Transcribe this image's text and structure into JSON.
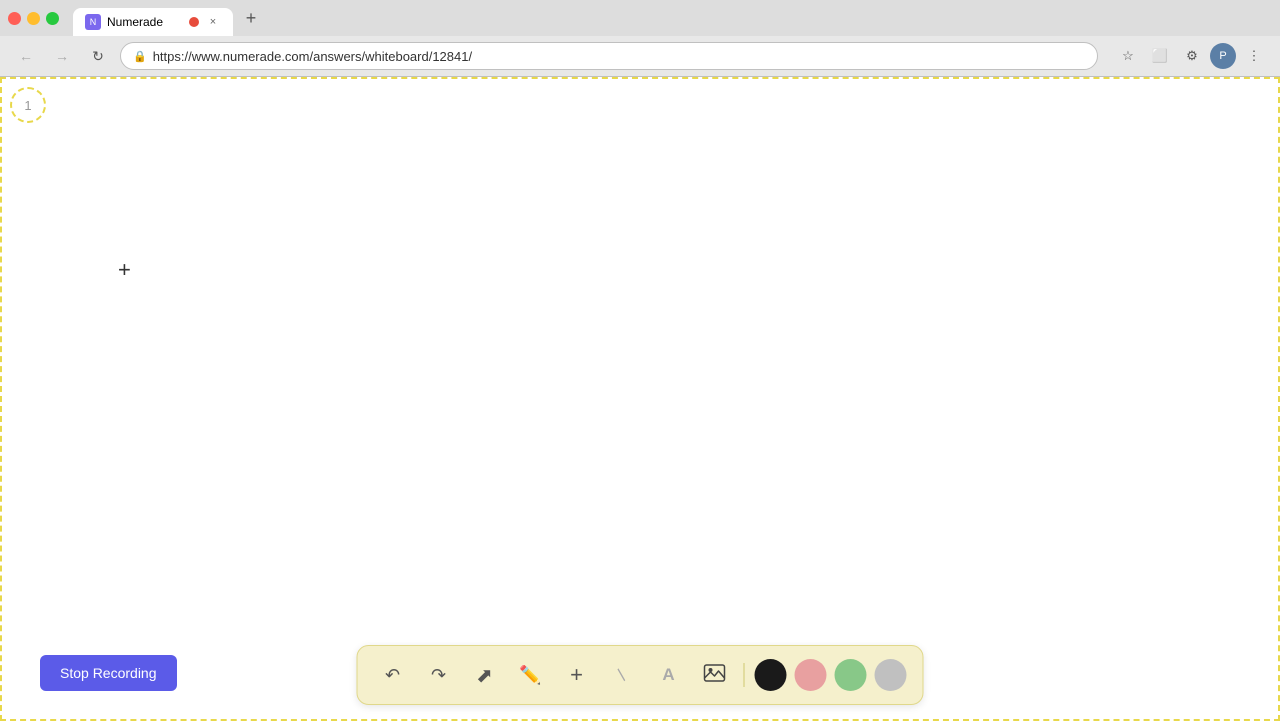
{
  "browser": {
    "window_controls": {
      "close_label": "×",
      "minimize_label": "−",
      "maximize_label": "+"
    },
    "tab": {
      "title": "Numerade",
      "favicon_label": "N",
      "close_label": "×"
    },
    "new_tab_label": "+",
    "url": "https://www.numerade.com/answers/whiteboard/12841/",
    "nav": {
      "back_label": "←",
      "forward_label": "→",
      "reload_label": "↺"
    }
  },
  "whiteboard": {
    "page_number": "1",
    "cursor_symbol": "+"
  },
  "toolbar": {
    "stop_recording_label": "Stop Recording",
    "tools": [
      {
        "name": "undo",
        "symbol": "↺",
        "label": "Undo"
      },
      {
        "name": "redo",
        "symbol": "↻",
        "label": "Redo"
      },
      {
        "name": "select",
        "symbol": "↖",
        "label": "Select"
      },
      {
        "name": "pen",
        "symbol": "✏",
        "label": "Pen"
      },
      {
        "name": "add",
        "symbol": "+",
        "label": "Add"
      },
      {
        "name": "line",
        "symbol": "/",
        "label": "Line"
      },
      {
        "name": "text",
        "symbol": "A",
        "label": "Text"
      },
      {
        "name": "image",
        "symbol": "🖼",
        "label": "Image"
      }
    ],
    "colors": [
      {
        "name": "black",
        "hex": "#1a1a1a"
      },
      {
        "name": "pink",
        "hex": "#e8a0a0"
      },
      {
        "name": "green",
        "hex": "#88c888"
      },
      {
        "name": "gray",
        "hex": "#c0c0c0"
      }
    ]
  }
}
